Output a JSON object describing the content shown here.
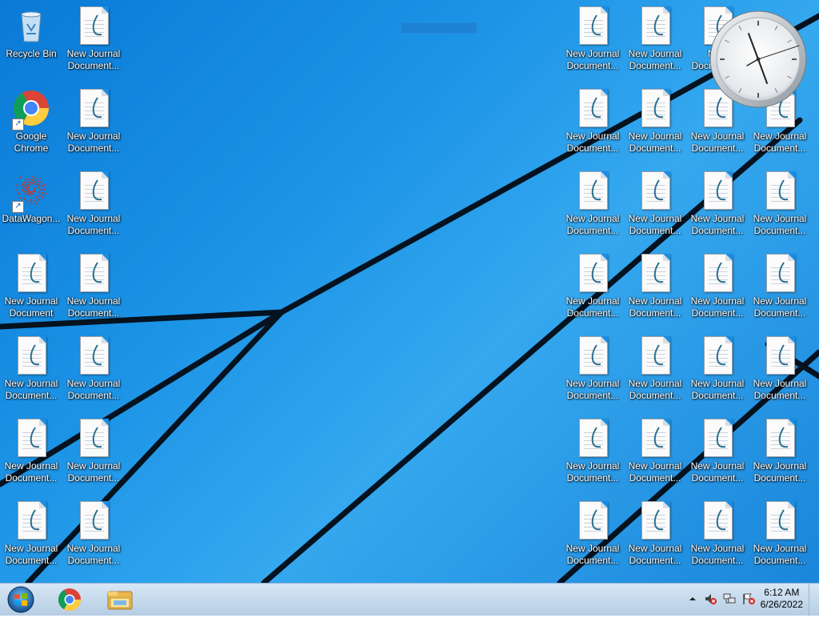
{
  "desktop": {
    "left_icons": [
      {
        "label1": "Recycle Bin",
        "label2": "",
        "icon": "recycle-bin-icon"
      },
      {
        "label1": "New Journal",
        "label2": "Document...",
        "icon": "journal-document-icon"
      },
      {
        "label1": "Google",
        "label2": "Chrome",
        "icon": "chrome-icon"
      },
      {
        "label1": "New Journal",
        "label2": "Document...",
        "icon": "journal-document-icon"
      },
      {
        "label1": "DataWagon...",
        "label2": "",
        "icon": "datawagon-icon"
      },
      {
        "label1": "New Journal",
        "label2": "Document...",
        "icon": "journal-document-icon"
      },
      {
        "label1": "New Journal",
        "label2": "Document",
        "icon": "journal-document-icon"
      },
      {
        "label1": "New Journal",
        "label2": "Document...",
        "icon": "journal-document-icon"
      },
      {
        "label1": "New Journal",
        "label2": "Document...",
        "icon": "journal-document-icon"
      },
      {
        "label1": "New Journal",
        "label2": "Document...",
        "icon": "journal-document-icon"
      },
      {
        "label1": "New Journal",
        "label2": "Document...",
        "icon": "journal-document-icon"
      },
      {
        "label1": "New Journal",
        "label2": "Document...",
        "icon": "journal-document-icon"
      },
      {
        "label1": "New Journal",
        "label2": "Document...",
        "icon": "journal-document-icon"
      },
      {
        "label1": "New Journal",
        "label2": "Document...",
        "icon": "journal-document-icon"
      }
    ],
    "right_icon_label1": "New Journal",
    "right_icon_label2": "Document...",
    "right_first_row_third_label1": "New"
  },
  "clock_gadget": {
    "name": "analog-clock"
  },
  "taskbar": {
    "start_label": "Start",
    "pinned": [
      "chrome-icon",
      "file-explorer-icon"
    ],
    "tray": {
      "time": "6:12 AM",
      "date": "6/26/2022"
    }
  },
  "colors": {
    "desktop": "#1b93e6",
    "taskbar": "#c4d9ee"
  }
}
